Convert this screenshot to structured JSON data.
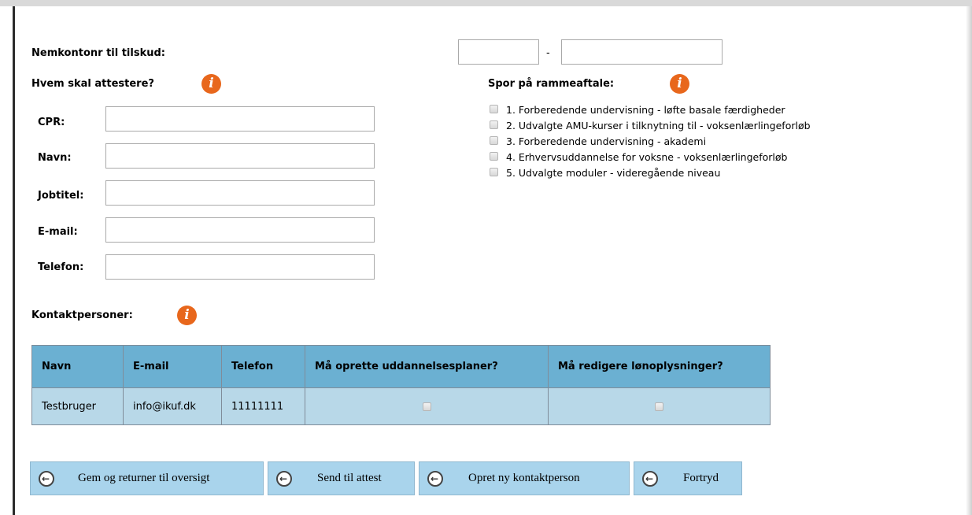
{
  "nemkonto": {
    "label": "Nemkontonr til tilskud:",
    "reg_value": "",
    "separator": "-",
    "konto_value": ""
  },
  "attest": {
    "heading": "Hvem skal attestere?",
    "fields": {
      "cpr": {
        "label": "CPR:",
        "value": ""
      },
      "navn": {
        "label": "Navn:",
        "value": ""
      },
      "jobtitel": {
        "label": "Jobtitel:",
        "value": ""
      },
      "email": {
        "label": "E-mail:",
        "value": ""
      },
      "telefon": {
        "label": "Telefon:",
        "value": ""
      }
    }
  },
  "spor": {
    "heading": "Spor på rammeaftale:",
    "items": [
      "1. Forberedende undervisning - løfte basale færdigheder",
      "2. Udvalgte AMU-kurser i tilknytning til - voksenlærlingeforløb",
      "3. Forberedende undervisning - akademi",
      "4. Erhvervsuddannelse for voksne - voksenlærlingeforløb",
      "5. Udvalgte moduler - videregående niveau"
    ]
  },
  "kontakt": {
    "heading": "Kontaktpersoner:",
    "columns": [
      "Navn",
      "E-mail",
      "Telefon",
      "Må oprette uddannelsesplaner?",
      "Må redigere lønoplysninger?"
    ],
    "rows": [
      {
        "navn": "Testbruger",
        "email": "info@ikuf.dk",
        "telefon": "11111111",
        "uddannelsesplaner": false,
        "loenoplysninger": false
      }
    ]
  },
  "buttons": {
    "gem": "Gem og returner til oversigt",
    "send": "Send til attest",
    "opret": "Opret ny kontaktperson",
    "fortryd": "Fortryd"
  },
  "colors": {
    "header_bg": "#6bb0d2",
    "row_bg": "#b8d8e8",
    "button_bg": "#a9d4ec",
    "info_icon": "#e8671c"
  },
  "icons": {
    "info": "info-icon",
    "button_arrow": "arrow-left-icon"
  }
}
